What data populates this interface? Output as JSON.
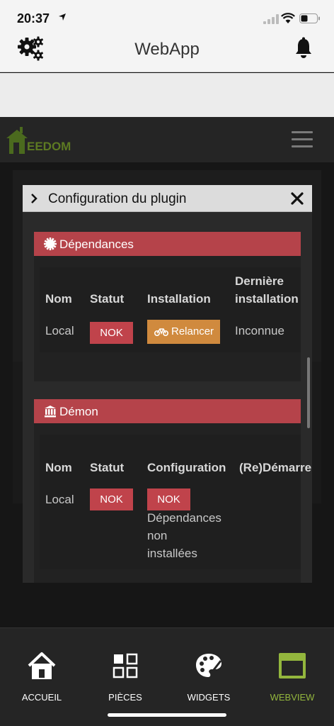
{
  "statusbar": {
    "time": "20:37"
  },
  "app": {
    "title": "WebApp"
  },
  "jeedom": {
    "logo_text": "EEDOM"
  },
  "modal": {
    "title": "Configuration du plugin",
    "dependances": {
      "heading": "Dépendances",
      "columns": {
        "nom": "Nom",
        "statut": "Statut",
        "installation": "Installation",
        "derniere_line1": "Dernière",
        "derniere_line2": "installation"
      },
      "row": {
        "nom": "Local",
        "statut": "NOK",
        "action": "Relancer",
        "derniere": "Inconnue"
      }
    },
    "demon": {
      "heading": "Démon",
      "columns": {
        "nom": "Nom",
        "statut": "Statut",
        "configuration": "Configuration",
        "redemarrer": "(Re)Démarrer"
      },
      "row": {
        "nom": "Local",
        "statut": "NOK",
        "config_status": "NOK",
        "config_line1": "Dépendances",
        "config_line2": "non",
        "config_line3": "installées"
      }
    }
  },
  "tabs": [
    {
      "label": "ACCUEIL",
      "icon": "home-icon"
    },
    {
      "label": "PIÈCES",
      "icon": "grid-icon"
    },
    {
      "label": "WIDGETS",
      "icon": "palette-icon"
    },
    {
      "label": "WEBVIEW",
      "icon": "window-icon",
      "active": true
    }
  ],
  "colors": {
    "accent": "#93b63d",
    "danger": "#c0434b",
    "warning": "#d08a3e",
    "panel_header": "#b5434a"
  }
}
